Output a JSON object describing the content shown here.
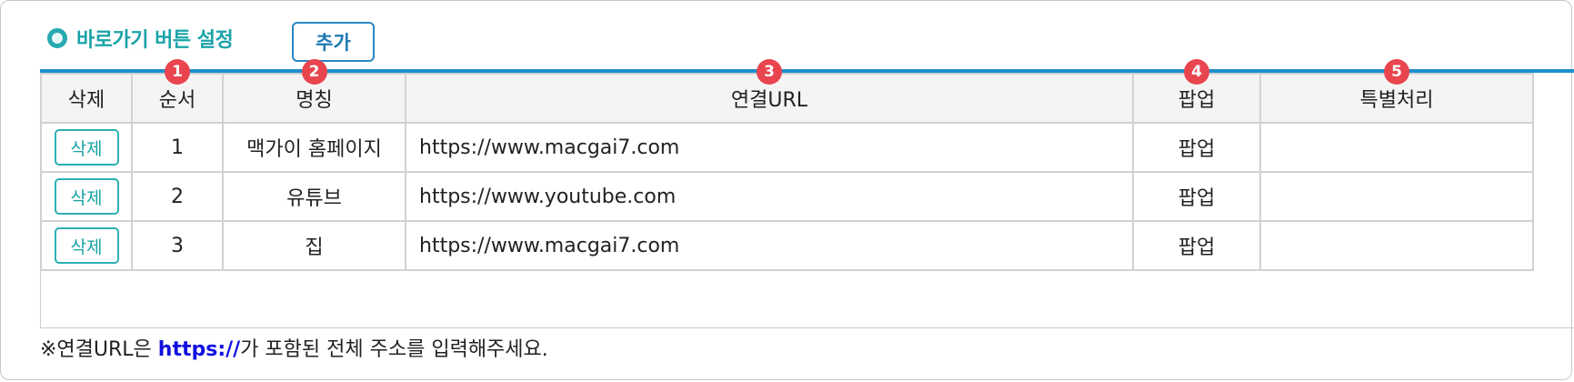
{
  "section": {
    "title": "바로가기 버튼 설정",
    "add_label": "추가"
  },
  "table": {
    "headers": [
      "삭제",
      "순서",
      "명칭",
      "연결URL",
      "팝업",
      "특별처리"
    ],
    "markers": [
      "1",
      "2",
      "3",
      "4",
      "5"
    ],
    "rows": [
      {
        "delete_label": "삭제",
        "order": "1",
        "name": "맥가이 홈페이지",
        "url": "https://www.macgai7.com",
        "popup": "팝업",
        "special": ""
      },
      {
        "delete_label": "삭제",
        "order": "2",
        "name": "유튜브",
        "url": "https://www.youtube.com",
        "popup": "팝업",
        "special": ""
      },
      {
        "delete_label": "삭제",
        "order": "3",
        "name": "집",
        "url": "https://www.macgai7.com",
        "popup": "팝업",
        "special": ""
      }
    ]
  },
  "note": {
    "prefix": "※연결URL은 ",
    "highlight": "https://",
    "suffix": "가 포함된 전체 주소를 입력해주세요."
  },
  "colors": {
    "accent": "#1aa3a9",
    "rule": "#1f8fcc",
    "marker": "#e8454f",
    "link_highlight": "#1010e0"
  }
}
